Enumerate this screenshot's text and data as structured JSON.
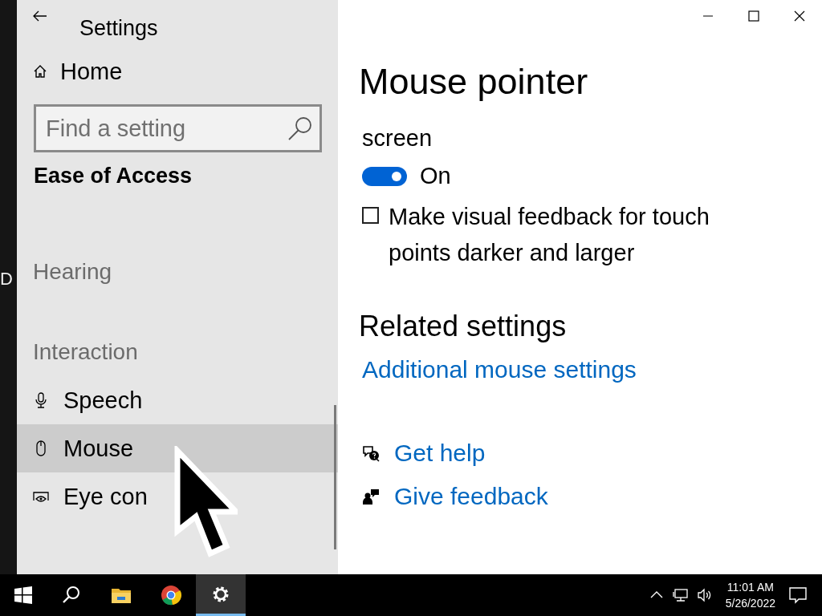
{
  "desktop": {
    "fragment": "D"
  },
  "window": {
    "title": "Settings"
  },
  "sidebar": {
    "home": "Home",
    "search": {
      "placeholder": "Find a setting"
    },
    "section": "Ease of Access",
    "items": [
      {
        "kind": "heading",
        "label": "Hearing"
      },
      {
        "kind": "heading",
        "label": "Interaction"
      },
      {
        "kind": "item",
        "label": "Speech",
        "selected": false
      },
      {
        "kind": "item",
        "label": "Mouse",
        "selected": true
      },
      {
        "kind": "item",
        "label": "Eye con",
        "selected": false
      }
    ]
  },
  "content": {
    "title": "Mouse pointer",
    "line_tail": "screen",
    "toggle": {
      "on": true,
      "label": "On"
    },
    "checkbox": {
      "checked": false,
      "label": "Make visual feedback for touch points darker and larger"
    },
    "related": {
      "heading": "Related settings",
      "links": [
        "Additional mouse settings"
      ]
    },
    "help": [
      {
        "label": "Get help"
      },
      {
        "label": "Give feedback"
      }
    ]
  },
  "taskbar": {
    "buttons": [
      {
        "selected": false
      },
      {
        "selected": false
      },
      {
        "selected": false
      },
      {
        "selected": false
      },
      {
        "selected": true
      }
    ],
    "clock": {
      "time": "11:01 AM",
      "date": "5/26/2022"
    }
  }
}
